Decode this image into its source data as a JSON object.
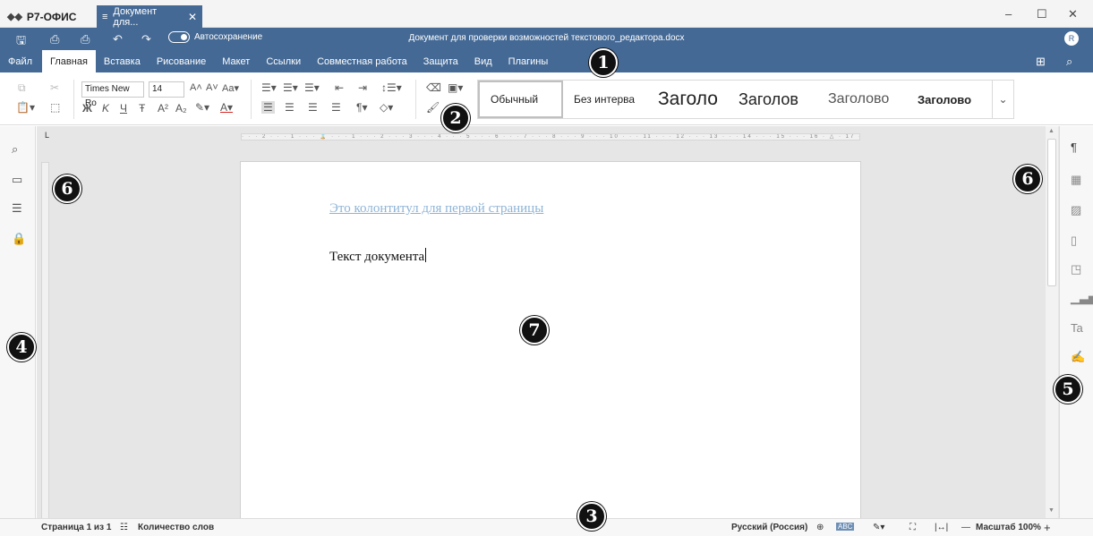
{
  "window": {
    "app_name": "Р7-ОФИС",
    "doc_tab_label": "Документ для...",
    "doc_title": "Документ для проверки возможностей текстового_редактора.docx",
    "user_initial": "R"
  },
  "quickbar": {
    "autosave_label": "Автосохранение"
  },
  "menu": {
    "items": [
      "Файл",
      "Главная",
      "Вставка",
      "Рисование",
      "Макет",
      "Ссылки",
      "Совместная работа",
      "Защита",
      "Вид",
      "Плагины"
    ],
    "active": "Главная"
  },
  "toolbar": {
    "font_name": "Times New Ro",
    "font_size": "14",
    "styles": [
      "Обычный",
      "Без интерва",
      "Заголо",
      "Заголов",
      "Заголово",
      "Заголово"
    ]
  },
  "document": {
    "header_text": "Это колонтитул для первой страницы",
    "body_text": "Текст документа"
  },
  "ruler": {
    "scale": "· · · 2 · · · 1 · · · ⌛ · · · 1 · · · 2 · · · 3 · · · 4 · · · 5 · · · 6 · · · 7 · · · 8 · · · 9 · · · 10 · · · 11 · · · 12 · · · 13 · · · 14 · · · 15 · · · 16 · △ · 17 · · ·"
  },
  "statusbar": {
    "page_info": "Страница 1 из 1",
    "word_count": "Количество слов",
    "language": "Русский (Россия)",
    "zoom": "Масштаб 100%"
  },
  "callouts": [
    "1",
    "2",
    "3",
    "4",
    "5",
    "6",
    "6",
    "7"
  ],
  "colors": {
    "header_blue": "#446995",
    "header_link": "#8fb4d6"
  }
}
